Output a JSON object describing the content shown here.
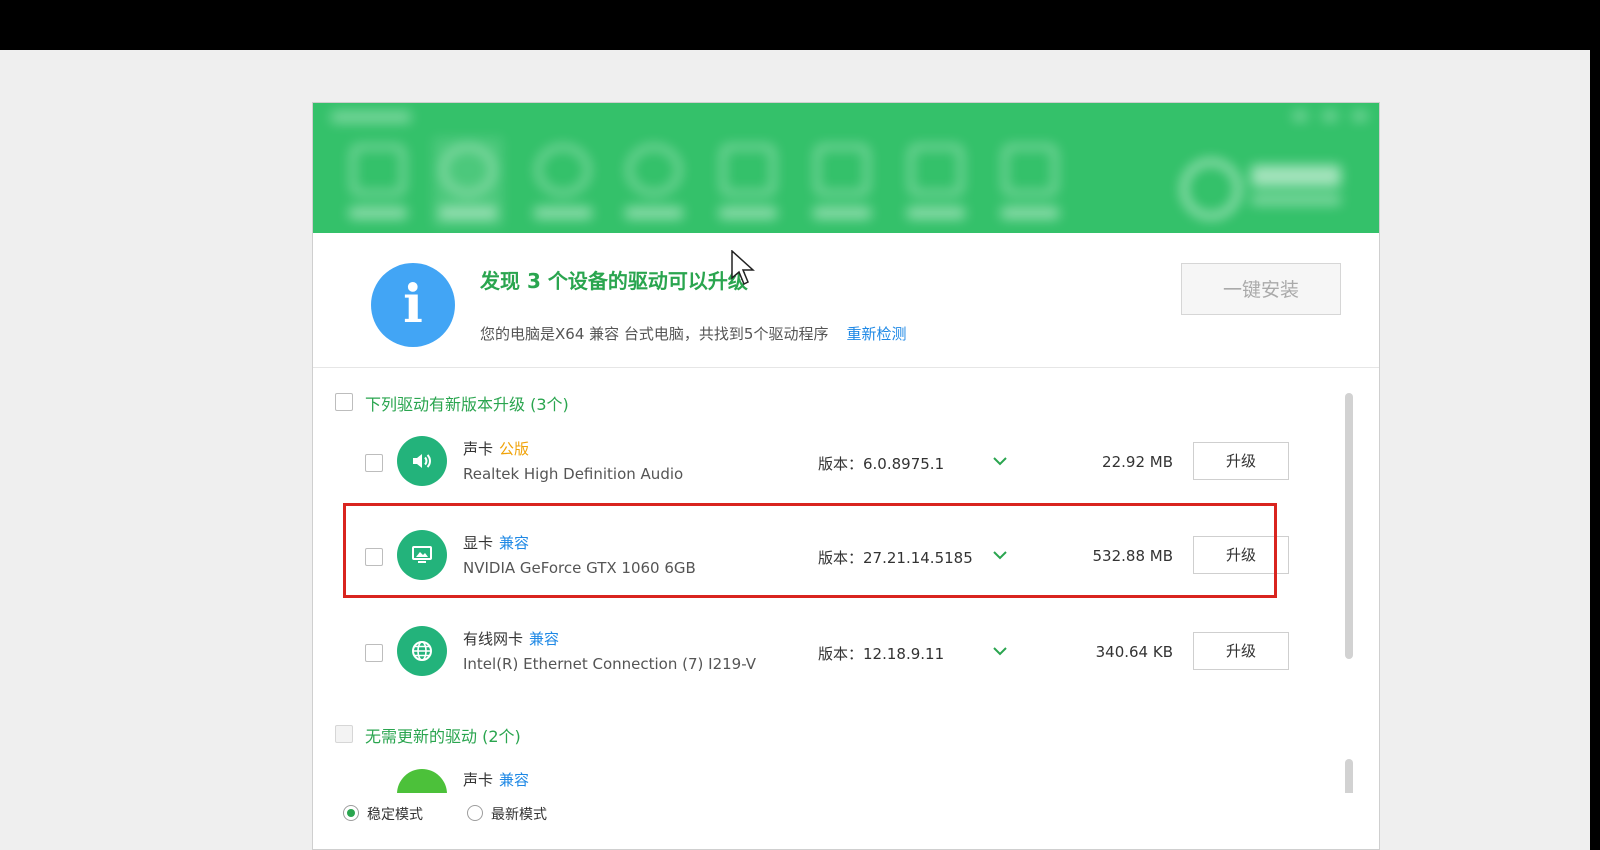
{
  "header": {
    "headline": "发现 3 个设备的驱动可以升级",
    "subline": "您的电脑是X64 兼容 台式电脑，共找到5个驱动程序",
    "rescan": "重新检测",
    "install_button": "一键安装"
  },
  "updates_section": {
    "title": "下列驱动有新版本升级 (3个)",
    "items": [
      {
        "type": "声卡",
        "tag": "公版",
        "tag_color": "#f0a30a",
        "name": "Realtek High Definition Audio",
        "version": "版本：6.0.8975.1",
        "size": "22.92 MB",
        "button": "升级",
        "icon": "speaker-icon"
      },
      {
        "type": "显卡",
        "tag": "兼容",
        "tag_color": "#1e88e5",
        "name": "NVIDIA GeForce GTX 1060 6GB",
        "version": "版本：27.21.14.5185",
        "size": "532.88 MB",
        "button": "升级",
        "icon": "display-icon"
      },
      {
        "type": "有线网卡",
        "tag": "兼容",
        "tag_color": "#1e88e5",
        "name": "Intel(R) Ethernet Connection (7) I219-V",
        "version": "版本：12.18.9.11",
        "size": "340.64 KB",
        "button": "升级",
        "icon": "globe-icon"
      }
    ]
  },
  "no_update_section": {
    "title": "无需更新的驱动 (2个)",
    "partial_item": {
      "type": "声卡",
      "tag": "兼容"
    }
  },
  "footer": {
    "stable_mode": "稳定模式",
    "latest_mode": "最新模式"
  },
  "colors": {
    "brand_green": "#34c16a",
    "accent_green": "#2aa54f",
    "highlight_red": "#d9241f"
  }
}
